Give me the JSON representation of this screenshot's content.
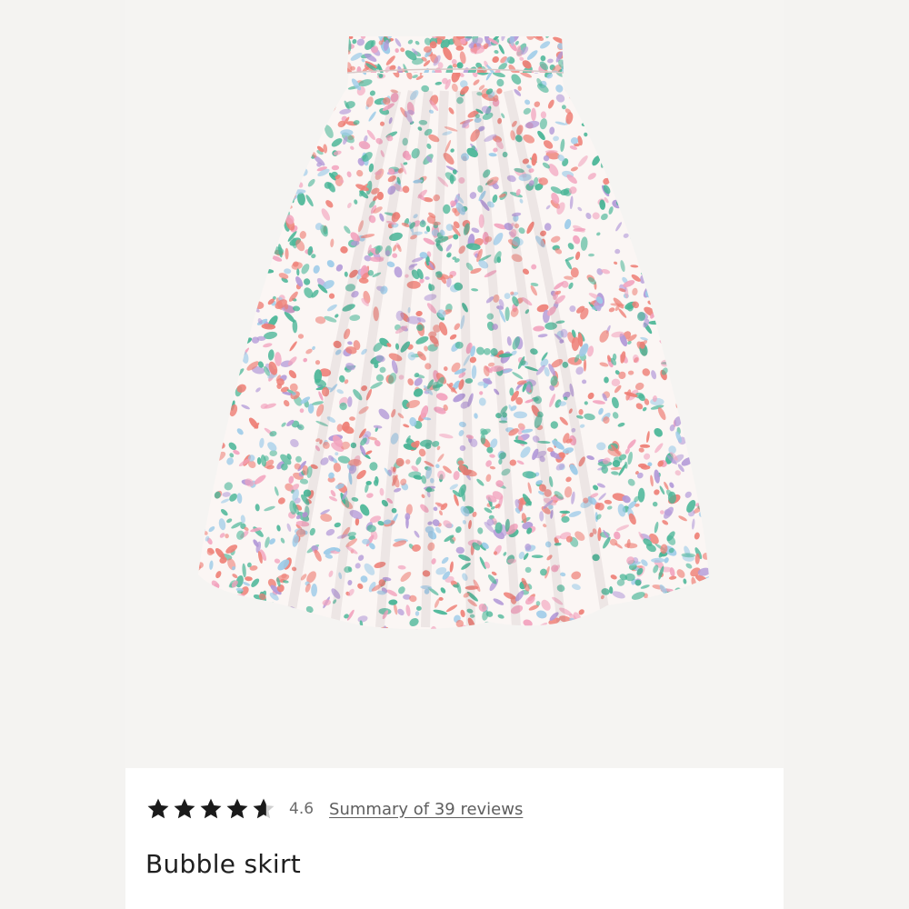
{
  "product": {
    "image_alt": "Floral bubble skirt",
    "colors": {
      "petal_coral": "#ee7f76",
      "petal_pink": "#f2a3be",
      "leaf_green": "#48b596",
      "leaf_blue": "#9ccbe8",
      "petal_lilac": "#b39ad8",
      "fabric_base": "#fbf6f4"
    },
    "rating": {
      "value": "4.6",
      "stars_filled": 4.6,
      "stars_total": 5,
      "reviews_link": "Summary of 39 reviews"
    },
    "name": "Bubble skirt"
  }
}
